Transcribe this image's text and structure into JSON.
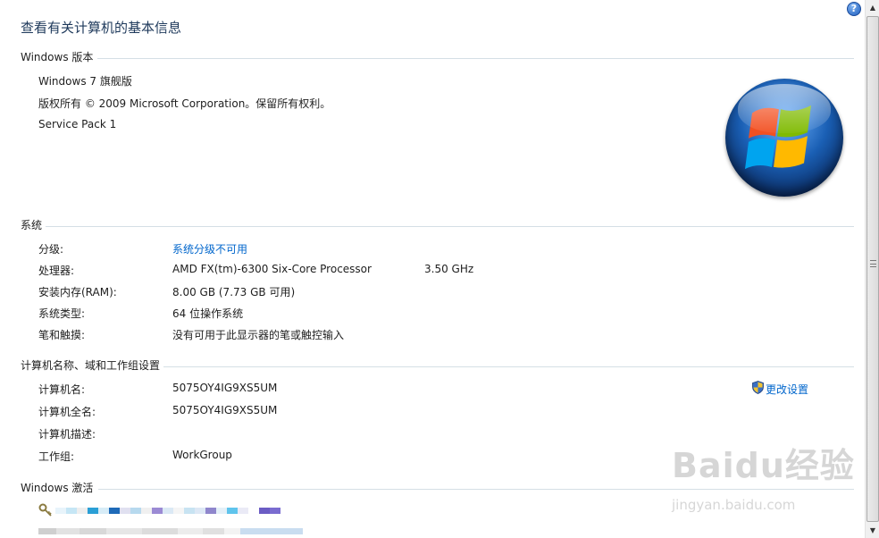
{
  "page_title": "查看有关计算机的基本信息",
  "help_icon": "help-icon",
  "sections": {
    "edition": {
      "header": "Windows 版本",
      "name": "Windows 7 旗舰版",
      "copyright": "版权所有 © 2009 Microsoft Corporation。保留所有权利。",
      "service_pack": "Service Pack 1"
    },
    "system": {
      "header": "系统",
      "rating_label": "分级:",
      "rating_value": "系统分级不可用",
      "processor_label": "处理器:",
      "processor_value": "AMD FX(tm)-6300 Six-Core Processor",
      "processor_speed": "3.50 GHz",
      "ram_label": "安装内存(RAM):",
      "ram_value": "8.00 GB (7.73 GB 可用)",
      "type_label": "系统类型:",
      "type_value": "64 位操作系统",
      "pen_label": "笔和触摸:",
      "pen_value": "没有可用于此显示器的笔或触控输入"
    },
    "computer_name": {
      "header": "计算机名称、域和工作组设置",
      "name_label": "计算机名:",
      "name_value": "5075OY4IG9XS5UM",
      "fullname_label": "计算机全名:",
      "fullname_value": "5075OY4IG9XS5UM",
      "desc_label": "计算机描述:",
      "workgroup_label": "工作组:",
      "workgroup_value": "WorkGroup",
      "change_settings": "更改设置"
    },
    "activation": {
      "header": "Windows 激活"
    }
  },
  "watermark": {
    "brand": "Baidu经验",
    "url": "jingyan.baidu.com"
  },
  "colors": {
    "title": "#1e395b",
    "link": "#0066cc",
    "divider": "#d5dfe5"
  }
}
